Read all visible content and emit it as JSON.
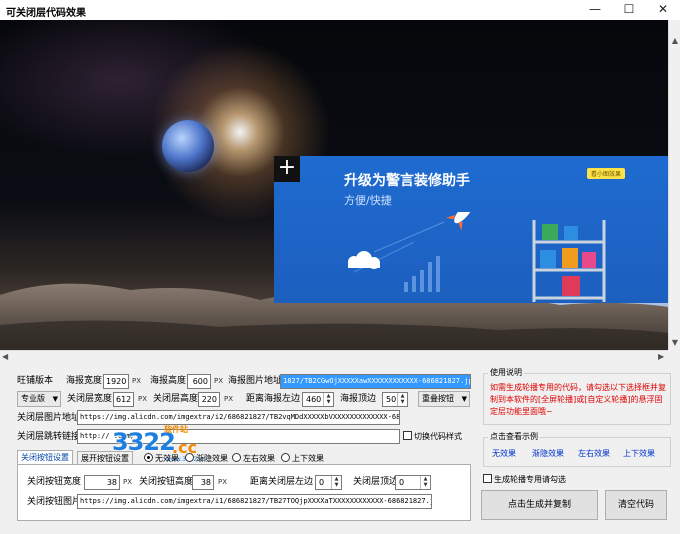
{
  "window": {
    "title": "可关闭层代码效果",
    "minimize_glyph": "—",
    "maximize_glyph": "☐",
    "close_glyph": "✕"
  },
  "banner": {
    "close_glyph": "+",
    "headline": "升级为警言装修助手",
    "subline": "方便/快捷",
    "tag": "看小图效果"
  },
  "form": {
    "version_label": "旺铺版本",
    "poster_width_label": "海报宽度",
    "poster_width_value": "1920",
    "poster_height_label": "海报高度",
    "poster_height_value": "600",
    "unit_px": "PX",
    "poster_img_label": "海报图片地址",
    "poster_img_value": "1827/TB2CGwOjXXXXXawXXXXXXXXXXXX-686821827.jpg",
    "version_value": "专业版",
    "close_layer_width_label": "关闭层宽度",
    "close_layer_width_value": "612",
    "close_layer_height_label": "关闭层高度",
    "close_layer_height_value": "220",
    "offset_left_label": "距离海报左边",
    "offset_left_value": "460",
    "offset_top_label": "海报顶边",
    "offset_top_value": "50",
    "overlay_button_value": "重叠按钮",
    "close_layer_img_label": "关闭层图片地址",
    "close_layer_img_value": "https://img.alicdn.com/imgextra/i2/686821827/TB2vqMDdXXXXXbVXXXXXXXXXXXXX-686821827.jpg",
    "close_layer_link_label": "关闭层跳转链接",
    "close_layer_link_value": "http://               .com/",
    "switch_code_label": "切换代码样式"
  },
  "tabs": [
    {
      "label": "关闭按钮设置"
    },
    {
      "label": "展开按钮设置"
    }
  ],
  "effects": [
    {
      "label": "无效果",
      "selected": true
    },
    {
      "label": "渐隐效果",
      "selected": false
    },
    {
      "label": "左右效果",
      "selected": false
    },
    {
      "label": "上下效果",
      "selected": false
    }
  ],
  "close_btn": {
    "width_label": "关闭按钮宽度",
    "width_value": "38",
    "height_label": "关闭按钮高度",
    "height_value": "38",
    "offset_left_label": "距离关闭层左边",
    "offset_left_value": "0",
    "offset_top_label": "关闭层顶边",
    "offset_top_value": "0",
    "img_label": "关闭按钮图片",
    "img_value": "https://img.alicdn.com/imgextra/i1/686821827/TB27TOQjpXXXXaTXXXXXXXXXXXX-686821827.jpg"
  },
  "usage": {
    "title": "使用说明",
    "note": "如需生成轮播专用的代码，请勾选以下选择框并复制到本软件的[全屏轮播]或[自定义轮播]的悬浮固定层功能里面哦~"
  },
  "examples": {
    "title": "点击查看示例",
    "links": [
      "无效果",
      "渐隐效果",
      "左右效果",
      "上下效果"
    ]
  },
  "carousel_check_label": "生成轮播专用请勾选",
  "buttons": {
    "generate": "点击生成并复制",
    "clear": "清空代码"
  },
  "watermark": {
    "main": "3322",
    "tld": ".cc",
    "site": "软件站",
    "url": "www.3322.cc"
  }
}
